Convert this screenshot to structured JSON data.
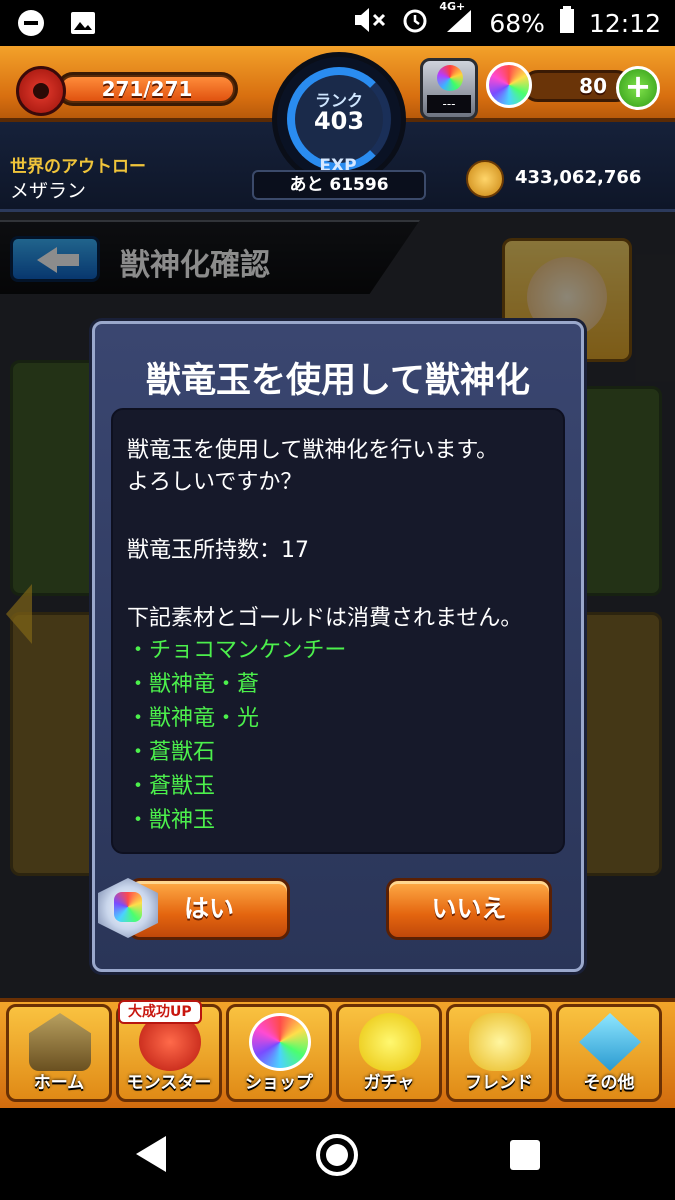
{
  "status_bar": {
    "battery_percent": "68%",
    "network": "4G+",
    "time": "12:12"
  },
  "header": {
    "stamina_text": "271/271",
    "stamina_fraction": 1.0,
    "rank_label": "ランク",
    "rank_value": "403",
    "exp_label": "EXP",
    "exp_remaining": "あと 61596",
    "orb_machine_text": "---",
    "orb_count": "80",
    "plus_label": "+",
    "player_title": "世界のアウトロー",
    "player_name": "メザラン",
    "gold_amount": "433,062,766"
  },
  "page": {
    "title": "獣神化確認"
  },
  "dialog": {
    "title": "獣竜玉を使用して獣神化",
    "message_line1": "獣竜玉を使用して獣神化を行います。",
    "message_line2": "よろしいですか？",
    "holding_count": "獣竜玉所持数：17",
    "note": "下記素材とゴールドは消費されません。",
    "materials": [
      "・チョコマンケンチー",
      "・獣神竜・蒼",
      "・獣神竜・光",
      "・蒼獣石",
      "・蒼獣玉",
      "・獣神玉"
    ],
    "yes_label": "はい",
    "no_label": "いいえ"
  },
  "bottom_nav": {
    "badge": "大成功UP",
    "items": [
      {
        "label": "ホーム",
        "icon": "home-icon"
      },
      {
        "label": "モンスター",
        "icon": "monster-icon"
      },
      {
        "label": "ショップ",
        "icon": "shop-icon"
      },
      {
        "label": "ガチャ",
        "icon": "gacha-icon"
      },
      {
        "label": "フレンド",
        "icon": "friend-icon"
      },
      {
        "label": "その他",
        "icon": "other-icon"
      }
    ]
  },
  "colors": {
    "header_orange": "#e0821a",
    "modal_blue": "#2f3a60",
    "material_green": "#4cf04c",
    "button_orange": "#e4650f"
  }
}
